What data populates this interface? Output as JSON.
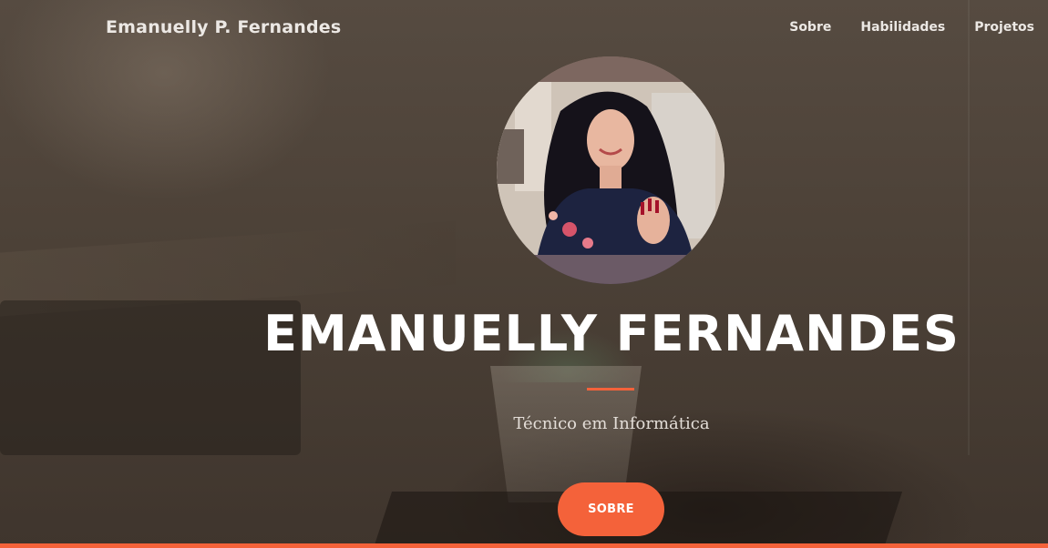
{
  "navbar": {
    "brand": "Emanuelly P. Fernandes",
    "links": [
      "Sobre",
      "Habilidades",
      "Projetos"
    ]
  },
  "masthead": {
    "title": "EMANUELLY FERNANDES",
    "subtitle": "Técnico em Informática",
    "cta_label": "SOBRE",
    "avatar_icon": "profile-photo"
  },
  "colors": {
    "accent": "#f4623a",
    "overlay": "#4a3f36",
    "text": "#ffffff"
  }
}
